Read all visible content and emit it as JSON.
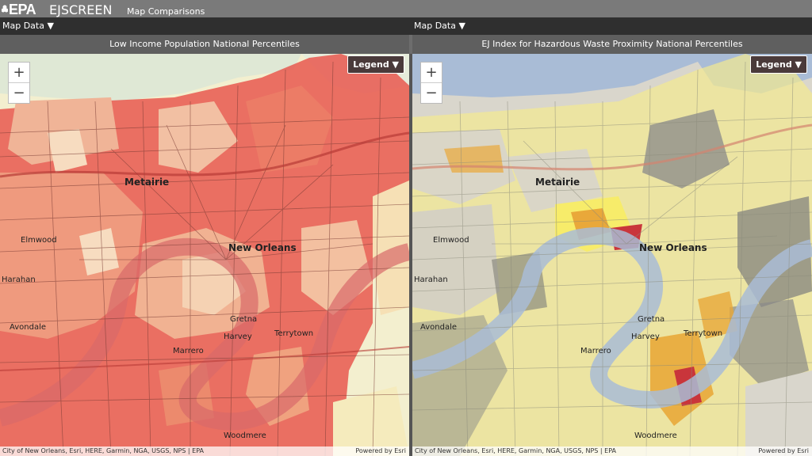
{
  "header": {
    "logo_text": "EPA",
    "app_name": "EJSCREEN",
    "page_title": "Map Comparisons"
  },
  "maps": [
    {
      "dropdown_label": "Map Data ▼",
      "title": "Low Income Population National Percentiles",
      "legend_label": "Legend ▼",
      "zoom_in": "+",
      "zoom_out": "−",
      "attribution": "City of New Orleans, Esri, HERE, Garmin, NGA, USGS, NPS | EPA",
      "powered_by": "Powered by Esri",
      "labels": {
        "metairie": "Metairie",
        "new_orleans": "New Orleans",
        "elmwood": "Elmwood",
        "harahan": "Harahan",
        "avondale": "Avondale",
        "marrero": "Marrero",
        "harvey": "Harvey",
        "gretna": "Gretna",
        "terrytown": "Terrytown",
        "woodmere": "Woodmere"
      }
    },
    {
      "dropdown_label": "Map Data ▼",
      "title": "EJ Index for Hazardous Waste Proximity National Percentiles",
      "legend_label": "Legend ▼",
      "zoom_in": "+",
      "zoom_out": "−",
      "attribution": "City of New Orleans, Esri, HERE, Garmin, NGA, USGS, NPS | EPA",
      "powered_by": "Powered by Esri",
      "labels": {
        "metairie": "Metairie",
        "new_orleans": "New Orleans",
        "elmwood": "Elmwood",
        "harahan": "Harahan",
        "avondale": "Avondale",
        "marrero": "Marrero",
        "harvey": "Harvey",
        "gretna": "Gretna",
        "terrytown": "Terrytown",
        "woodmere": "Woodmere"
      }
    }
  ],
  "colors": {
    "left_high": "#e8584f",
    "left_mid": "#ef9a7e",
    "left_low": "#f5d2b3",
    "right_yellow": "#f7ec6a",
    "right_orange": "#e9a83a",
    "right_red": "#c9353b",
    "right_gray": "#8a8a8a",
    "water": "#a9bcd6"
  }
}
